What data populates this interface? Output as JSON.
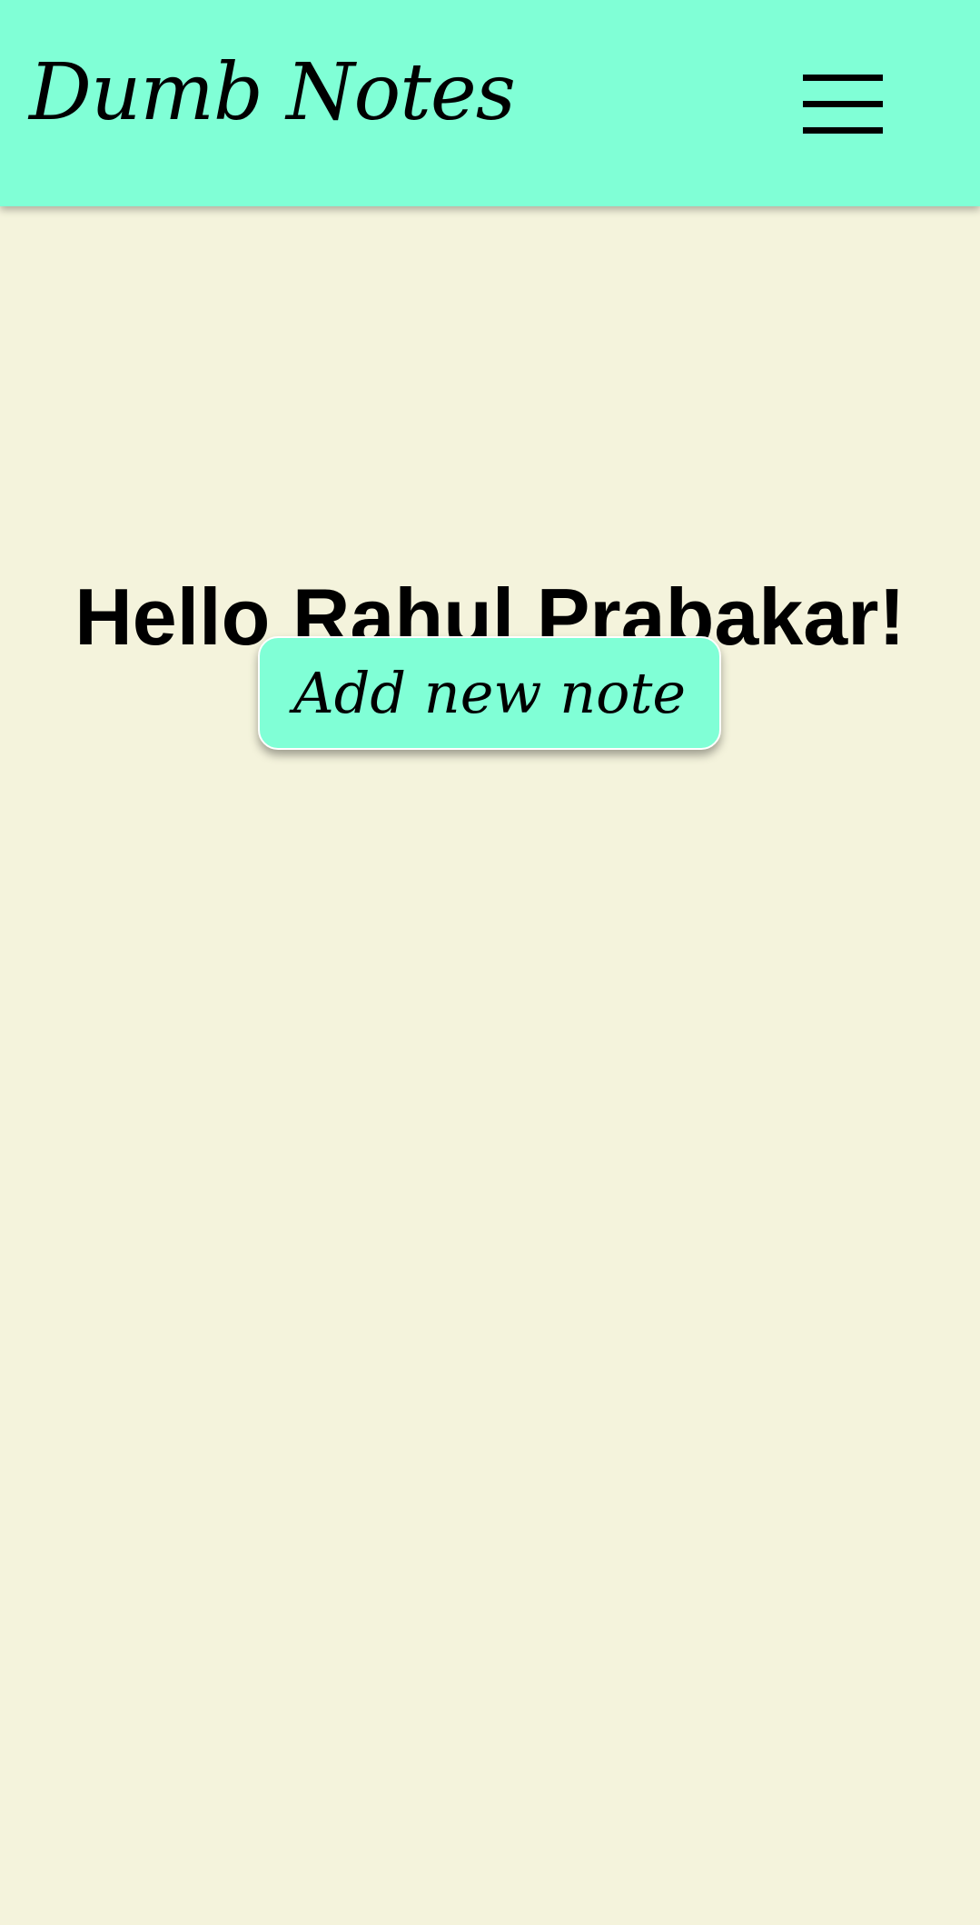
{
  "header": {
    "title": "Dumb Notes",
    "menu_icon": "hamburger-menu-icon"
  },
  "main": {
    "greeting": "Hello Rahul Prabakar!",
    "add_note_label": "Add new note"
  },
  "colors": {
    "header_bg": "#80ffd6",
    "page_bg": "#f4f3dc",
    "button_bg": "#80ffd6",
    "text": "#000000"
  }
}
